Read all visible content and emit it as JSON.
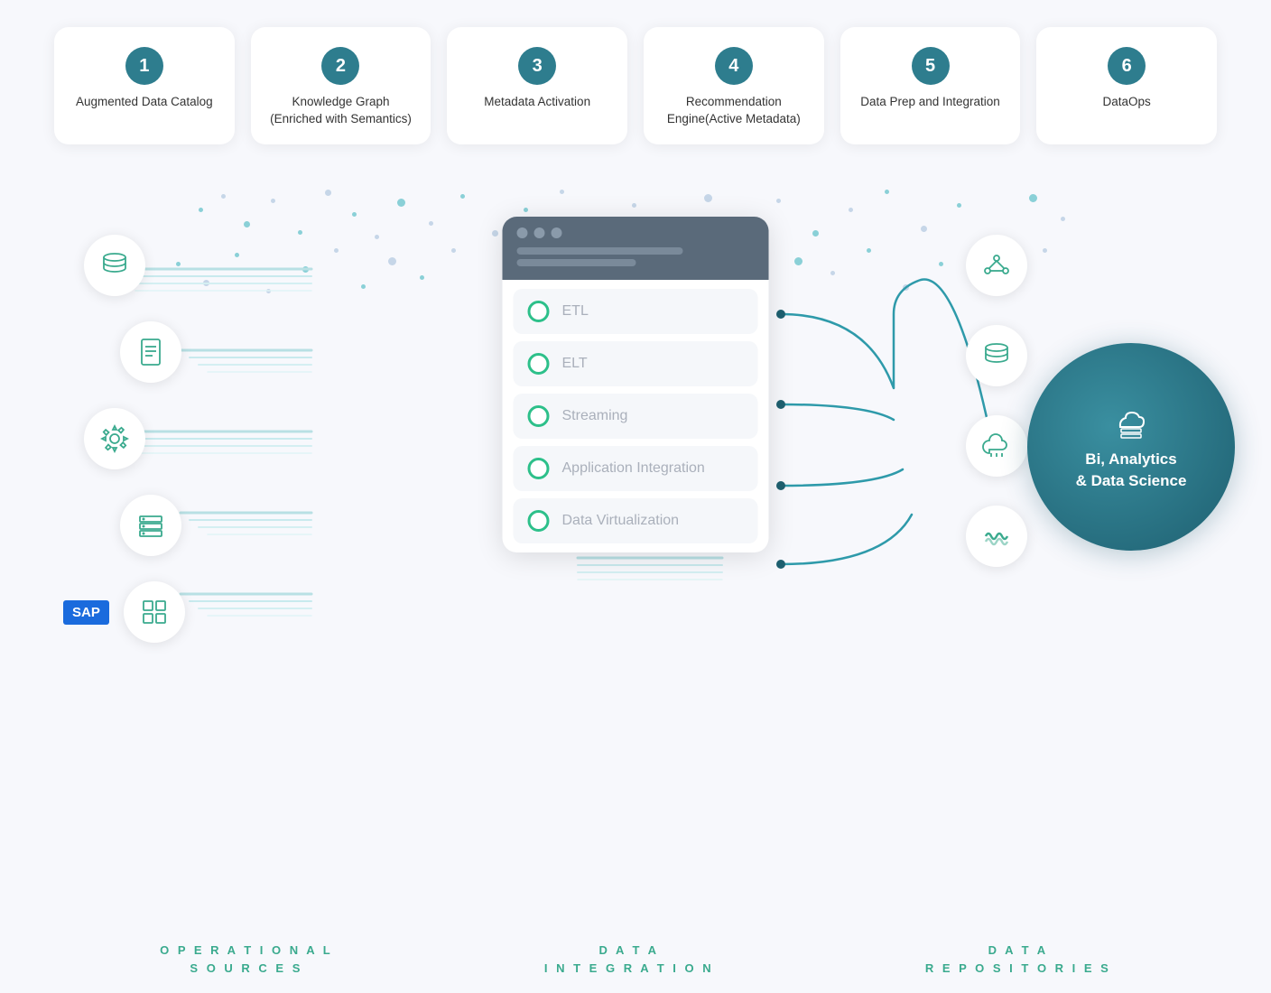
{
  "cards": [
    {
      "number": "1",
      "label": "Augmented Data Catalog"
    },
    {
      "number": "2",
      "label": "Knowledge Graph (Enriched with Semantics)"
    },
    {
      "number": "3",
      "label": "Metadata Activation"
    },
    {
      "number": "4",
      "label": "Recommendation Engine(Active Metadata)"
    },
    {
      "number": "5",
      "label": "Data Prep and Integration"
    },
    {
      "number": "6",
      "label": "DataOps"
    }
  ],
  "integration_items": [
    {
      "label": "ETL"
    },
    {
      "label": "ELT"
    },
    {
      "label": "Streaming"
    },
    {
      "label": "Application Integration"
    },
    {
      "label": "Data Virtualization"
    }
  ],
  "bottom_labels": [
    {
      "line1": "O P E R A T I O N A L",
      "line2": "S O U R C E S"
    },
    {
      "line1": "D A T A",
      "line2": "I N T E G R A T I O N"
    },
    {
      "line1": "D A T A",
      "line2": "R E P O S I T O R I E S"
    }
  ],
  "bi_circle": {
    "line1": "Bi, Analytics",
    "line2": "& Data Science"
  },
  "sap_label": "SAP"
}
